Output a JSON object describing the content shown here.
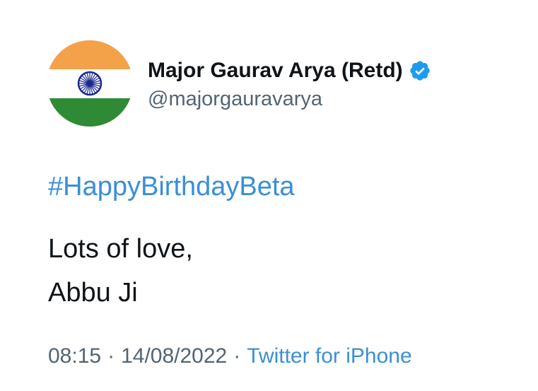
{
  "author": {
    "display_name": "Major Gaurav Arya (Retd)",
    "handle": "@majorgauravarya",
    "verified": true,
    "avatar_icon": "indian-flag-icon"
  },
  "tweet": {
    "hashtag": "#HappyBirthdayBeta",
    "lines": [
      "Lots of love,",
      "Abbu Ji"
    ]
  },
  "meta": {
    "time": "08:15",
    "separator": "·",
    "date": "14/08/2022",
    "source": "Twitter for iPhone"
  },
  "colors": {
    "link": "#3a8fd6",
    "verified_badge": "#1d9bf0",
    "saffron": "#f4a24a",
    "green": "#2f8a35",
    "chakra": "#1b2a8f",
    "secondary_text": "#536471"
  }
}
